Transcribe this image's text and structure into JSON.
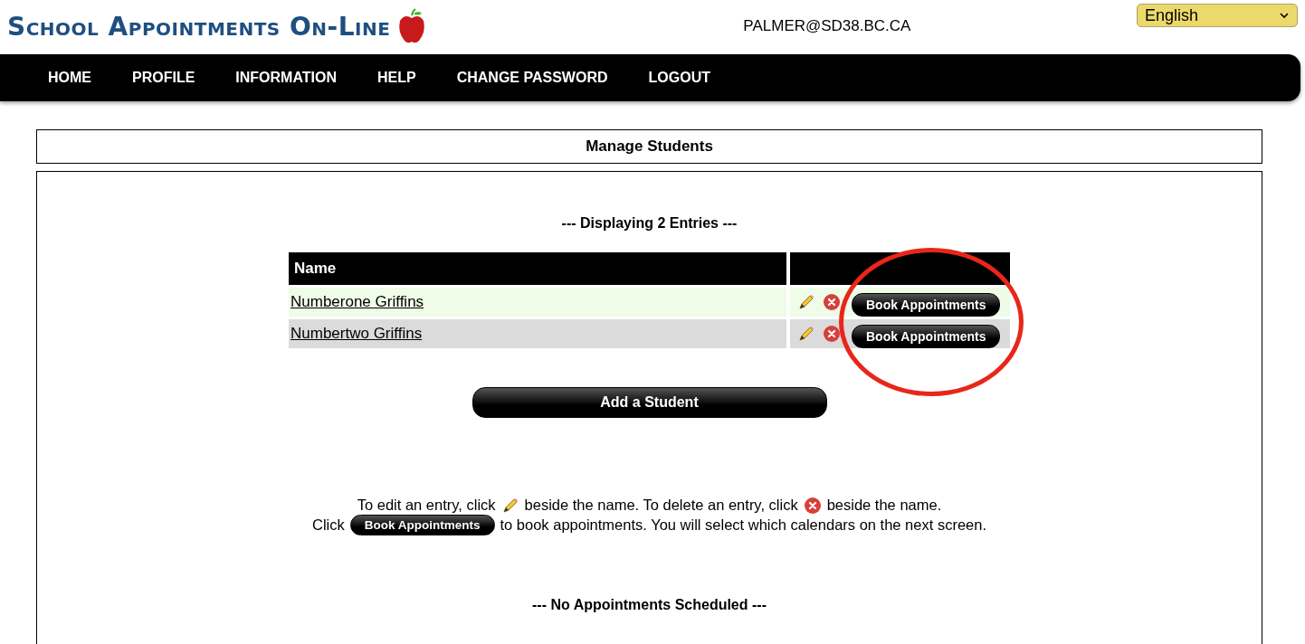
{
  "header": {
    "logo": "School Appointments On-Line",
    "user": "PALMER@SD38.BC.CA",
    "language": "English"
  },
  "nav": [
    "HOME",
    "PROFILE",
    "INFORMATION",
    "HELP",
    "CHANGE PASSWORD",
    "LOGOUT"
  ],
  "page_title": "Manage Students",
  "entries_caption": "--- Displaying 2 Entries ---",
  "table": {
    "columns": [
      "Name"
    ],
    "rows": [
      {
        "name": "Numberone Griffins",
        "action": "Book Appointments"
      },
      {
        "name": "Numbertwo Griffins",
        "action": "Book Appointments"
      }
    ]
  },
  "add_button": "Add a Student",
  "help": {
    "edit_before": "To edit an entry, click",
    "edit_after": "beside the name. To delete an entry, click",
    "delete_after": "beside the name.",
    "click": "Click",
    "button": "Book Appointments",
    "book_after": "to book appointments. You will select which calendars on the next screen."
  },
  "footer_caption": "--- No Appointments Scheduled ---"
}
